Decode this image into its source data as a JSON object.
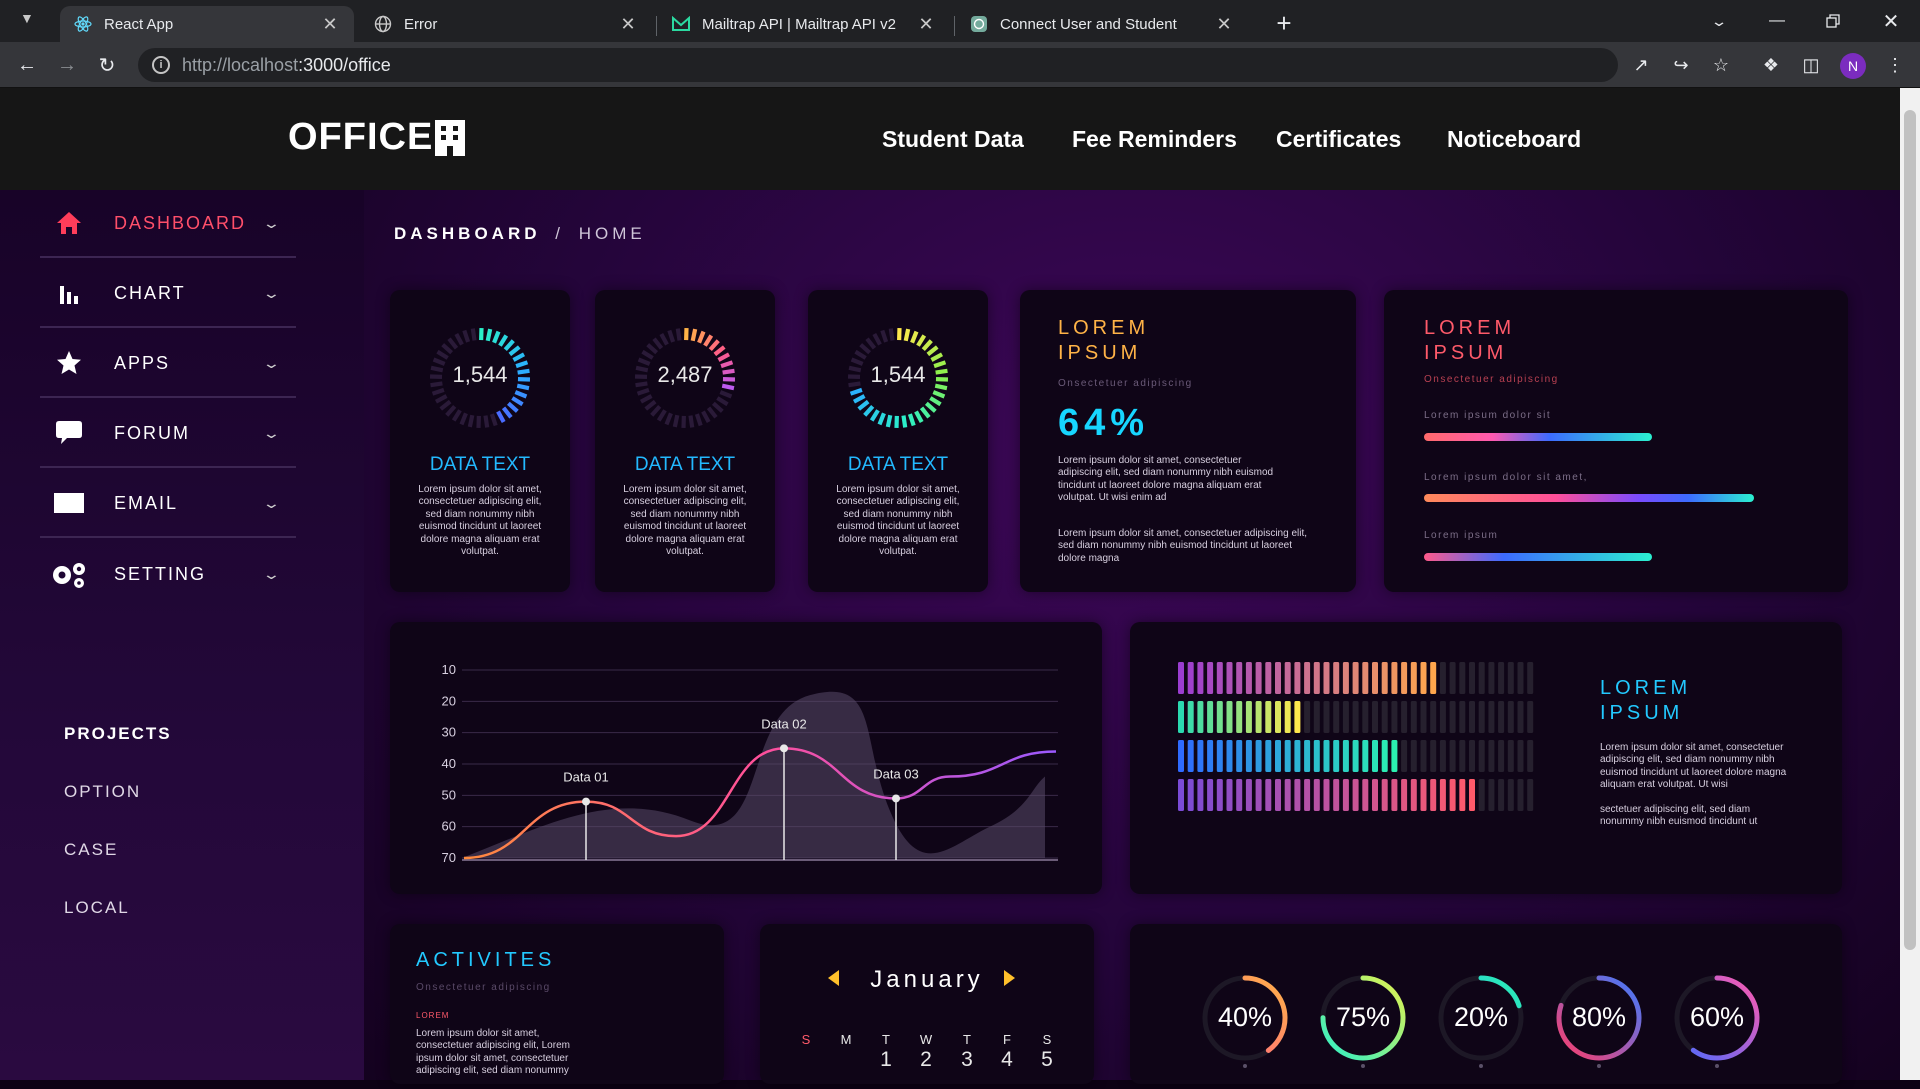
{
  "browser": {
    "tabs": [
      {
        "title": "React App"
      },
      {
        "title": "Error"
      },
      {
        "title": "Mailtrap API | Mailtrap API v2"
      },
      {
        "title": "Connect User and Student"
      }
    ],
    "url_host": "http://localhost",
    "url_rest": ":3000/office",
    "profile_initial": "N"
  },
  "header": {
    "logo": "OFFICE",
    "nav": [
      "Student Data",
      "Fee Reminders",
      "Certificates",
      "Noticeboard"
    ]
  },
  "sidebar": {
    "items": [
      {
        "label": "DASHBOARD",
        "icon": "home-icon"
      },
      {
        "label": "CHART",
        "icon": "bar-chart-icon"
      },
      {
        "label": "APPS",
        "icon": "star-icon"
      },
      {
        "label": "FORUM",
        "icon": "chat-bubble-icon"
      },
      {
        "label": "EMAIL",
        "icon": "envelope-icon"
      },
      {
        "label": "SETTING",
        "icon": "gears-icon"
      }
    ],
    "projects_title": "PROJECTS",
    "projects": [
      "OPTION",
      "CASE",
      "LOCAL"
    ]
  },
  "breadcrumb": {
    "section": "DASHBOARD",
    "sep": "/",
    "page": "HOME"
  },
  "stat_cards": [
    {
      "value": "1,544",
      "title": "DATA TEXT",
      "text": "Lorem ipsum dolor sit amet, consectetuer adipiscing elit, sed diam nonummy nibh euismod tincidunt ut laoreet dolore magna aliquam erat volutpat."
    },
    {
      "value": "2,487",
      "title": "DATA TEXT",
      "text": "Lorem ipsum dolor sit amet, consectetuer adipiscing elit, sed diam nonummy nibh euismod tincidunt ut laoreet dolore magna aliquam erat volutpat."
    },
    {
      "value": "1,544",
      "title": "DATA TEXT",
      "text": "Lorem ipsum dolor sit amet, consectetuer adipiscing elit, sed diam nonummy nibh euismod tincidunt ut laoreet dolore magna aliquam erat volutpat."
    }
  ],
  "percent_card": {
    "title_line1": "LOREM",
    "title_line2": "IPSUM",
    "subtitle": "Onsectetuer adipiscing",
    "percent": "64%",
    "text1": "Lorem ipsum dolor sit amet, consectetuer adipiscing elit, sed diam nonummy nibh euismod tincidunt ut laoreet dolore magna aliquam erat volutpat. Ut wisi enim ad",
    "text2": "Lorem ipsum dolor sit amet, consectetuer adipiscing elit, sed diam nonummy nibh euismod tincidunt ut laoreet dolore magna"
  },
  "bars_card": {
    "title_line1": "LOREM",
    "title_line2": "IPSUM",
    "subtitle": "Onsectetuer adipiscing",
    "bars": [
      {
        "label": "Lorem ipsum dolor sit",
        "fraction": 0.69
      },
      {
        "label": "Lorem ipsum dolor sit amet,",
        "fraction": 1.0
      },
      {
        "label": "Lorem ipsum",
        "fraction": 0.69
      }
    ]
  },
  "chart_data": {
    "type": "line",
    "x": [
      0,
      1,
      2,
      3,
      4,
      5,
      6
    ],
    "y_ticks": [
      "10",
      "20",
      "30",
      "40",
      "50",
      "60",
      "70"
    ],
    "ylim": [
      10,
      70
    ],
    "y_inverted": true,
    "series": [
      {
        "values": [
          70,
          52,
          63,
          35,
          51,
          44,
          36
        ]
      }
    ],
    "annotations": [
      {
        "label": "Data 01",
        "x": 1,
        "y": 52
      },
      {
        "label": "Data 02",
        "x": 3,
        "y": 35
      },
      {
        "label": "Data 03",
        "x": 4,
        "y": 51
      }
    ],
    "colors": {
      "line_start": "#ff8a3d",
      "line_mid": "#ff4f9a",
      "line_end": "#9b59ff",
      "area": "#5a4a6a"
    }
  },
  "equalizer_card": {
    "title_line1": "LOREM",
    "title_line2": "IPSUM",
    "text1": "Lorem ipsum dolor sit amet, consectetuer adipiscing elit, sed diam nonummy nibh euismod tincidunt ut laoreet dolore magna aliquam erat volutpat. Ut wisi",
    "text2": "sectetuer adipiscing elit, sed diam nonummy nibh euismod tincidunt ut",
    "rows": [
      {
        "filled": 0.72,
        "from": "#9b3dd1",
        "to": "#ffa64d"
      },
      {
        "filled": 0.34,
        "from": "#2bd9b0",
        "to": "#ffe84d"
      },
      {
        "filled": 0.62,
        "from": "#2f6bff",
        "to": "#2bf0b0"
      },
      {
        "filled": 0.84,
        "from": "#7a4bd6",
        "to": "#ff5a6a"
      }
    ]
  },
  "activities": {
    "title": "ACTIVITES",
    "subtitle": "Onsectetuer adipiscing",
    "tag": "LOREM",
    "text": "Lorem ipsum dolor sit amet, consectetuer adipiscing elit, Lorem ipsum dolor sit amet, consectetuer adipiscing elit, sed diam nonummy"
  },
  "calendar": {
    "month": "January",
    "days": [
      "S",
      "M",
      "T",
      "W",
      "T",
      "F",
      "S"
    ],
    "dates": [
      "1",
      "2",
      "3",
      "4",
      "5"
    ]
  },
  "rings": [
    {
      "label": "40%",
      "value": 0.4,
      "from": "#ff5a8a",
      "to": "#ffb347"
    },
    {
      "label": "75%",
      "value": 0.75,
      "from": "#2bf0c8",
      "to": "#e6f24d"
    },
    {
      "label": "20%",
      "value": 0.2,
      "from": "#2bb0ff",
      "to": "#2bf0b0"
    },
    {
      "label": "80%",
      "value": 0.8,
      "from": "#ff3d6a",
      "to": "#3d7bff"
    },
    {
      "label": "60%",
      "value": 0.6,
      "from": "#4b6bff",
      "to": "#ff5ab0"
    }
  ]
}
